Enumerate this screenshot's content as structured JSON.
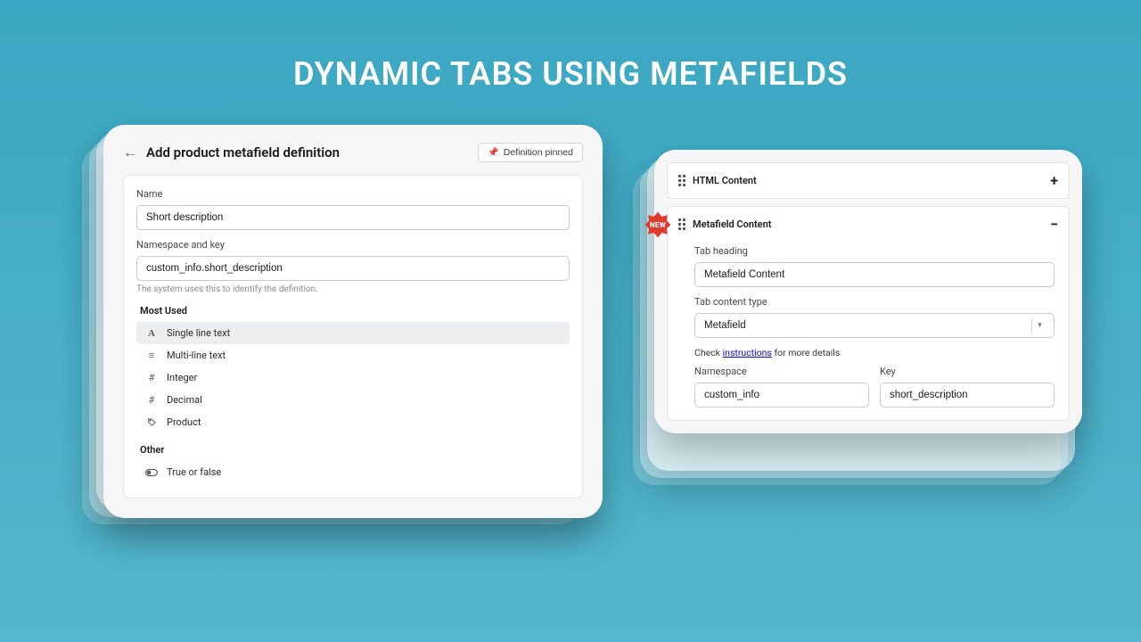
{
  "hero_title": "DYNAMIC TABS USING METAFIELDS",
  "left": {
    "title": "Add product metafield definition",
    "pin_btn": "Definition pinned",
    "name_label": "Name",
    "name_value": "Short description",
    "ns_label": "Namespace and key",
    "ns_value": "custom_info.short_description",
    "ns_help": "The system uses this to identify the definition.",
    "group_most": "Most Used",
    "type_single": "Single line text",
    "type_multi": "Multi-line text",
    "type_integer": "Integer",
    "type_decimal": "Decimal",
    "type_product": "Product",
    "group_other": "Other",
    "type_bool": "True or false"
  },
  "right": {
    "html_block": "HTML Content",
    "meta_block": "Metafield Content",
    "tab_heading_label": "Tab heading",
    "tab_heading_value": "Metafield Content",
    "tab_type_label": "Tab content type",
    "tab_type_value": "Metafield",
    "check_text_1": "Check ",
    "check_link": "instructions",
    "check_text_2": " for more details",
    "ns_label": "Namespace",
    "ns_value": "custom_info",
    "key_label": "Key",
    "key_value": "short_description",
    "badge": "NEW"
  }
}
